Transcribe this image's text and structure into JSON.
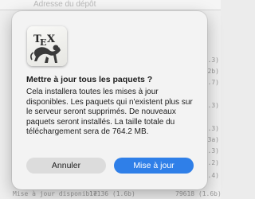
{
  "background_window": {
    "column_header": "Adresse du dépôt",
    "right_column_values": [
      "0.3)",
      "2.2b)",
      "9.7)",
      "1.3)",
      "0.3)",
      "0.3a)",
      "1.3)",
      "2.2)",
      "1.4)"
    ],
    "bottom_row": {
      "status": "Mise à jour disponible",
      "local_version": "17136 (1.6b)",
      "remote_version": "79618 (1.6b)"
    }
  },
  "dialog": {
    "app_icon": "tex-live-utility-icon",
    "title": "Mettre à jour tous les paquets ?",
    "message": "Cela installera toutes les mises à jour disponibles.  Les paquets qui n'existent plus sur le serveur seront supprimés.  De nouveaux paquets seront installés. La taille totale du téléchargement sera de 764.2 MB.",
    "cancel_label": "Annuler",
    "confirm_label": "Mise à jour"
  },
  "colors": {
    "accent": "#2f7fe8",
    "dialog_background": "#f3f3f3",
    "cancel_button": "#dcdcdc"
  }
}
